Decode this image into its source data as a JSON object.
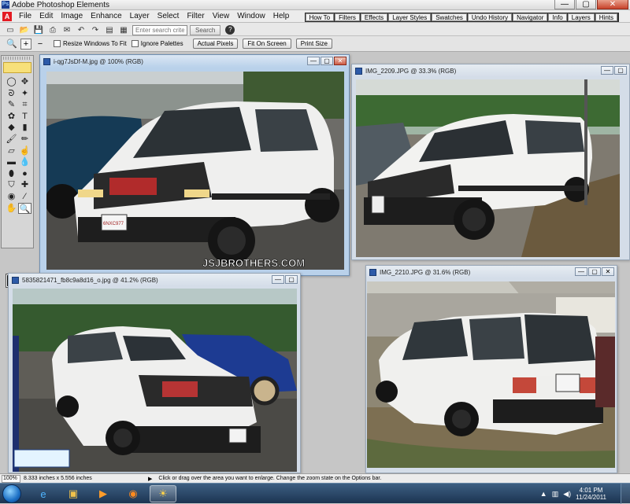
{
  "window": {
    "title": "Adobe Photoshop Elements",
    "min": "—",
    "max": "▢",
    "close": "✕"
  },
  "menu": [
    "File",
    "Edit",
    "Image",
    "Enhance",
    "Layer",
    "Select",
    "Filter",
    "View",
    "Window",
    "Help"
  ],
  "search": {
    "placeholder": "Enter search criteria",
    "button": "Search"
  },
  "palette_tabs": [
    "How To",
    "Filters",
    "Effects",
    "Layer Styles",
    "Swatches",
    "Undo History",
    "Navigator",
    "Info",
    "Layers",
    "Hints"
  ],
  "options": {
    "resize_label": "Resize Windows To Fit",
    "ignore_label": "Ignore Palettes",
    "actual_pixels": "Actual Pixels",
    "fit_on_screen": "Fit On Screen",
    "print_size": "Print Size"
  },
  "documents": [
    {
      "name": "i-qg7JsDf-M.jpg @ 100% (RGB)",
      "watermark": "JSJBROTHERS.COM"
    },
    {
      "name": "IMG_2209.JPG @ 33.3% (RGB)"
    },
    {
      "name": "5835821471_fb8c9a8d16_o.jpg @ 41.2% (RGB)"
    },
    {
      "name": "IMG_2210.JPG @ 31.6% (RGB)"
    }
  ],
  "plate_text": "6NXC977",
  "status": {
    "zoom": "100%",
    "doc_size": "8.333 inches x 5.556 inches",
    "hint": "Click or drag over the area you want to enlarge. Change the zoom state on the Options bar."
  },
  "taskbar": {
    "time": "4:01 PM",
    "date": "11/24/2011"
  },
  "icons": {
    "tools": [
      "move-tool-icon",
      "zoom-tool-icon",
      "hand-tool-icon",
      "eyedropper-icon",
      "marquee-icon",
      "lasso-icon",
      "magic-wand-icon",
      "selection-brush-icon",
      "text-icon",
      "crop-icon",
      "red-eye-icon",
      "healing-brush-icon",
      "clone-stamp-icon",
      "eraser-icon",
      "pencil-icon",
      "brush-icon",
      "paint-bucket-icon",
      "gradient-icon",
      "shape-icon",
      "blur-icon",
      "sponge-icon",
      "dodge-icon",
      "burn-icon",
      "cookie-cutter-icon",
      "straighten-icon",
      "recompose-icon"
    ]
  },
  "colors": {
    "titlebar_active": "#b9d1ea",
    "workspace": "#c6c6c6",
    "taskbar": "#1c3451"
  }
}
